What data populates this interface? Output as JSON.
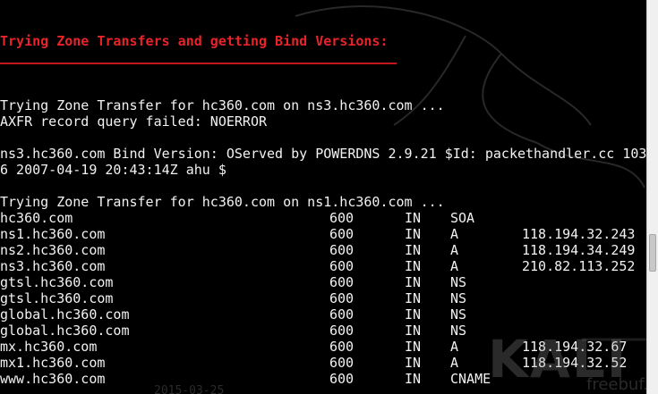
{
  "heading": "Trying Zone Transfers and getting Bind Versions:",
  "lines": {
    "zt_ns3": "Trying Zone Transfer for hc360.com on ns3.hc360.com ...",
    "axfr_failed": "AXFR record query failed: NOERROR",
    "bind_version_1": "ns3.hc360.com Bind Version: OServed by POWERDNS 2.9.21 $Id: packethandler.cc 103",
    "bind_version_2": "6 2007-04-19 20:43:14Z ahu $",
    "zt_ns1": "Trying Zone Transfer for hc360.com on ns1.hc360.com ..."
  },
  "records": [
    {
      "name": "hc360.com",
      "ttl": "600",
      "class": "IN",
      "type": "SOA",
      "address": ""
    },
    {
      "name": "ns1.hc360.com",
      "ttl": "600",
      "class": "IN",
      "type": "A",
      "address": "118.194.32.243"
    },
    {
      "name": "ns2.hc360.com",
      "ttl": "600",
      "class": "IN",
      "type": "A",
      "address": "118.194.34.249"
    },
    {
      "name": "ns3.hc360.com",
      "ttl": "600",
      "class": "IN",
      "type": "A",
      "address": "210.82.113.252"
    },
    {
      "name": "gtsl.hc360.com",
      "ttl": "600",
      "class": "IN",
      "type": "NS",
      "address": ""
    },
    {
      "name": "gtsl.hc360.com",
      "ttl": "600",
      "class": "IN",
      "type": "NS",
      "address": ""
    },
    {
      "name": "global.hc360.com",
      "ttl": "600",
      "class": "IN",
      "type": "NS",
      "address": ""
    },
    {
      "name": "global.hc360.com",
      "ttl": "600",
      "class": "IN",
      "type": "NS",
      "address": ""
    },
    {
      "name": "mx.hc360.com",
      "ttl": "600",
      "class": "IN",
      "type": "A",
      "address": "118.194.32.67"
    },
    {
      "name": "mx1.hc360.com",
      "ttl": "600",
      "class": "IN",
      "type": "A",
      "address": "118.194.32.52"
    },
    {
      "name": "www.hc360.com",
      "ttl": "600",
      "class": "IN",
      "type": "CNAME",
      "address": ""
    }
  ],
  "watermarks": {
    "brand": "KALI L",
    "site": "freebuf.org",
    "date": "2015-03-25"
  },
  "colors": {
    "background": "#000000",
    "text": "#f2f2f2",
    "heading": "#e8242a"
  },
  "icons": {
    "background_art": "kali-dragon-icon"
  }
}
